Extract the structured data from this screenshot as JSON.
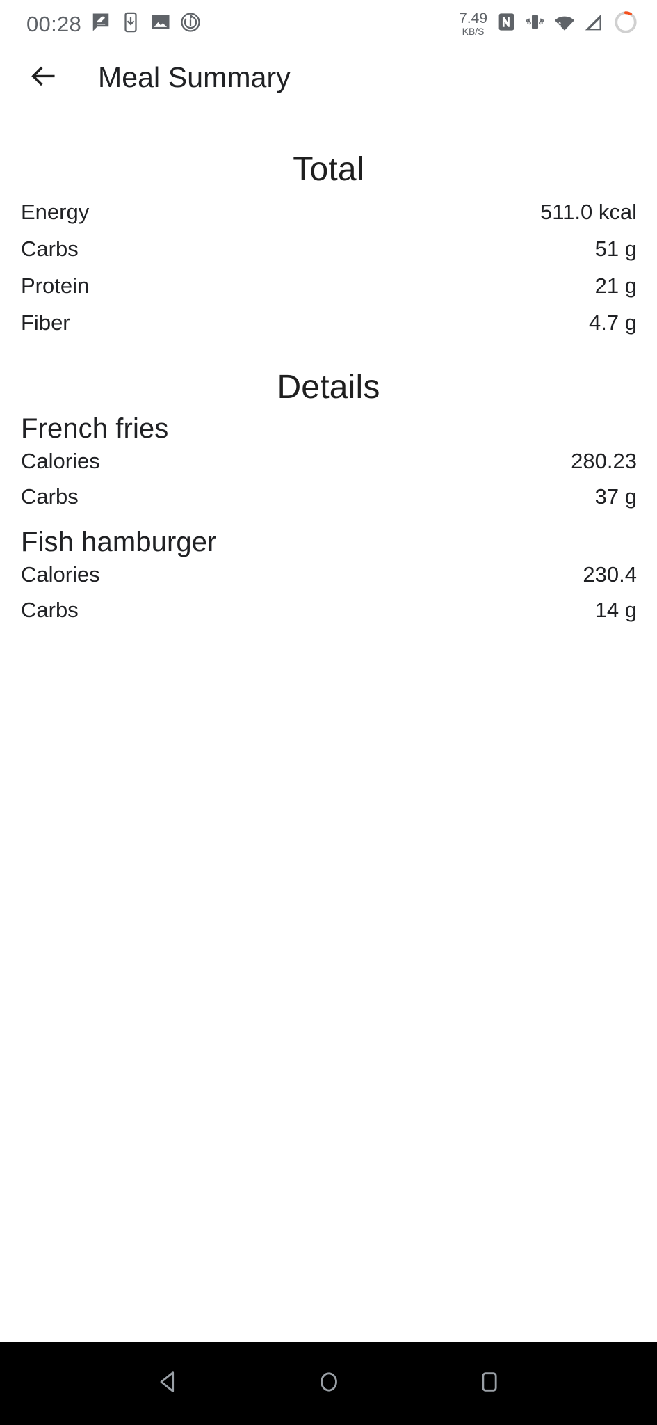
{
  "status_bar": {
    "clock": "00:28",
    "left_icons": [
      {
        "name": "message-compose-icon"
      },
      {
        "name": "download-to-phone-icon"
      },
      {
        "name": "image-icon"
      },
      {
        "name": "sync-rotate-icon"
      }
    ],
    "network_speed": {
      "value": "7.49",
      "unit": "KB/S"
    },
    "right_icons": [
      {
        "name": "nfc-icon"
      },
      {
        "name": "vibrate-icon"
      },
      {
        "name": "wifi-data-transfer-icon"
      },
      {
        "name": "cellular-signal-icon"
      },
      {
        "name": "battery-ring-icon"
      }
    ],
    "colors": {
      "icon": "#5f6368",
      "battery_accent": "#f4511e"
    }
  },
  "app_bar": {
    "back_label": "Back",
    "title": "Meal Summary"
  },
  "main": {
    "total": {
      "heading": "Total",
      "rows": [
        {
          "label": "Energy",
          "value": "511.0 kcal"
        },
        {
          "label": "Carbs",
          "value": "51 g"
        },
        {
          "label": "Protein",
          "value": "21 g"
        },
        {
          "label": "Fiber",
          "value": "4.7 g"
        }
      ]
    },
    "details": {
      "heading": "Details",
      "items": [
        {
          "name": "French fries",
          "rows": [
            {
              "label": "Calories",
              "value": "280.23"
            },
            {
              "label": "Carbs",
              "value": "37 g"
            }
          ]
        },
        {
          "name": "Fish hamburger",
          "rows": [
            {
              "label": "Calories",
              "value": "230.4"
            },
            {
              "label": "Carbs",
              "value": "14 g"
            }
          ]
        }
      ]
    }
  },
  "nav_bar": {
    "buttons": [
      {
        "name": "back-nav-button",
        "icon": "triangle-left-icon"
      },
      {
        "name": "home-nav-button",
        "icon": "circle-icon"
      },
      {
        "name": "recents-nav-button",
        "icon": "square-icon"
      }
    ],
    "color": "#000000",
    "icon_color": "#9aa0a6"
  }
}
